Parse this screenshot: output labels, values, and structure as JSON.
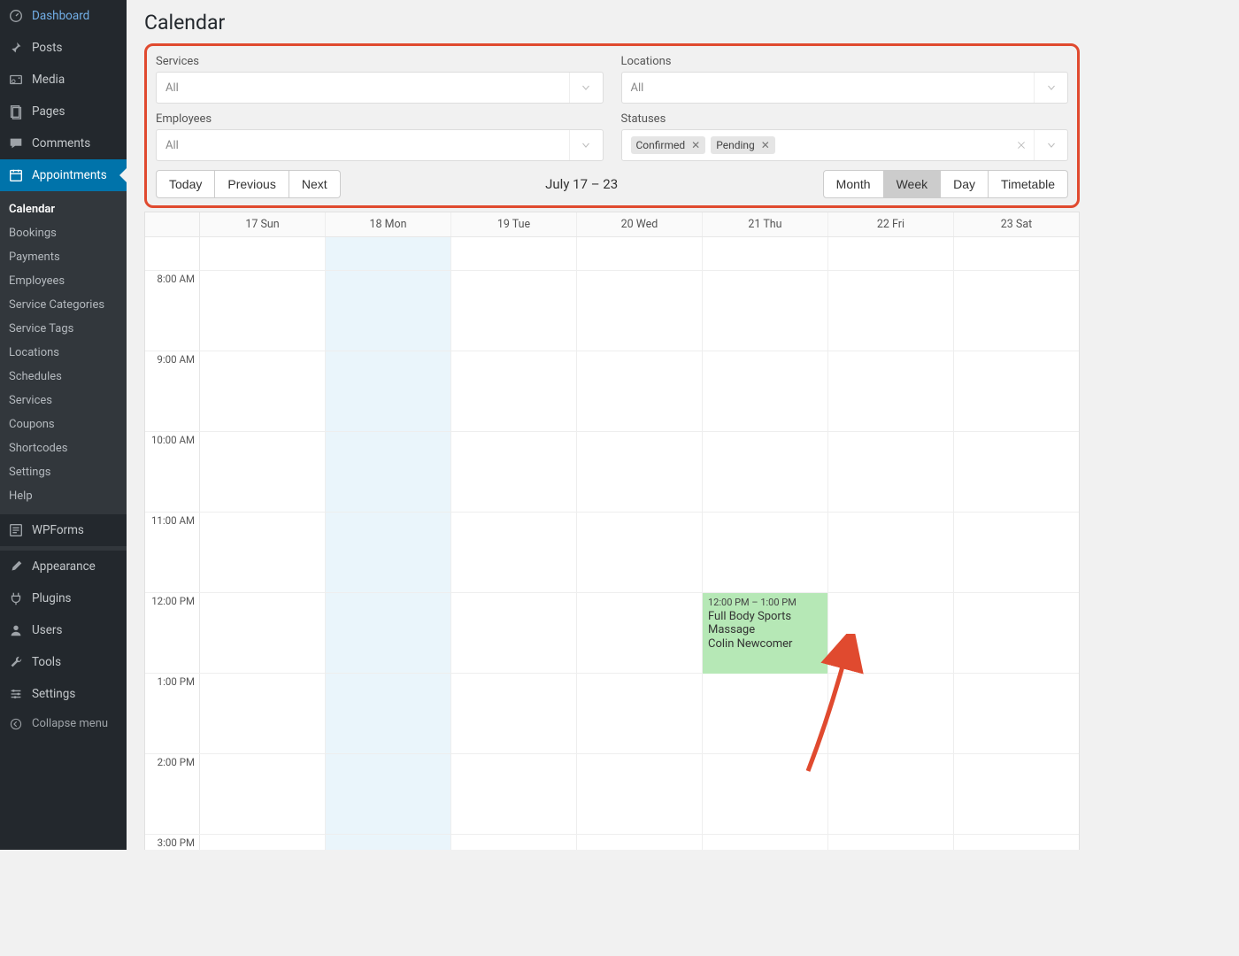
{
  "sidebar": {
    "top": [
      {
        "label": "Dashboard",
        "icon": "dashboard"
      },
      {
        "label": "Posts",
        "icon": "pin"
      },
      {
        "label": "Media",
        "icon": "media"
      },
      {
        "label": "Pages",
        "icon": "pages"
      },
      {
        "label": "Comments",
        "icon": "comment"
      },
      {
        "label": "Appointments",
        "icon": "calendar",
        "active": true
      }
    ],
    "submenu": [
      {
        "label": "Calendar",
        "current": true
      },
      {
        "label": "Bookings"
      },
      {
        "label": "Payments"
      },
      {
        "label": "Employees"
      },
      {
        "label": "Service Categories"
      },
      {
        "label": "Service Tags"
      },
      {
        "label": "Locations"
      },
      {
        "label": "Schedules"
      },
      {
        "label": "Services"
      },
      {
        "label": "Coupons"
      },
      {
        "label": "Shortcodes"
      },
      {
        "label": "Settings"
      },
      {
        "label": "Help"
      }
    ],
    "bottom": [
      {
        "label": "WPForms",
        "icon": "form"
      },
      {
        "label": "Appearance",
        "icon": "brush"
      },
      {
        "label": "Plugins",
        "icon": "plug"
      },
      {
        "label": "Users",
        "icon": "user"
      },
      {
        "label": "Tools",
        "icon": "wrench"
      },
      {
        "label": "Settings",
        "icon": "sliders"
      }
    ],
    "collapse": "Collapse menu"
  },
  "page": {
    "title": "Calendar"
  },
  "filters": {
    "services": {
      "label": "Services",
      "value": "All"
    },
    "locations": {
      "label": "Locations",
      "value": "All"
    },
    "employees": {
      "label": "Employees",
      "value": "All"
    },
    "statuses": {
      "label": "Statuses",
      "tags": [
        "Confirmed",
        "Pending"
      ]
    }
  },
  "toolbar": {
    "today": "Today",
    "previous": "Previous",
    "next": "Next",
    "range": "July 17 – 23",
    "views": {
      "month": "Month",
      "week": "Week",
      "day": "Day",
      "timetable": "Timetable",
      "active": "week"
    }
  },
  "calendar": {
    "days": [
      "17 Sun",
      "18 Mon",
      "19 Tue",
      "20 Wed",
      "21 Thu",
      "22 Fri",
      "23 Sat"
    ],
    "today_index": 1,
    "hours": [
      "",
      "8:00 AM",
      "9:00 AM",
      "10:00 AM",
      "11:00 AM",
      "12:00 PM",
      "1:00 PM",
      "2:00 PM",
      "3:00 PM"
    ],
    "event": {
      "day_index": 4,
      "hour_index": 5,
      "time": "12:00 PM – 1:00 PM",
      "title": "Full Body Sports Massage",
      "person": "Colin Newcomer"
    }
  }
}
